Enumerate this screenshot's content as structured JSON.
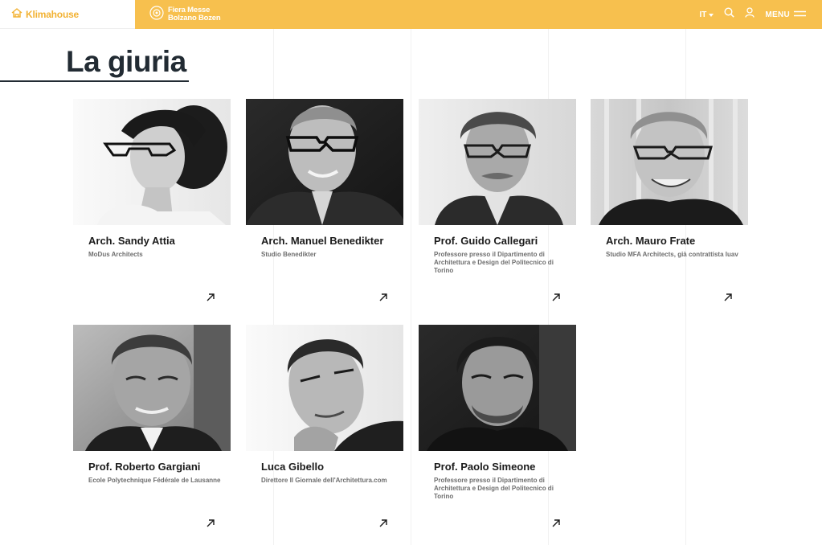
{
  "header": {
    "brand": "Klimahouse",
    "fiera_line1": "Fiera Messe",
    "fiera_line2": "Bolzano Bozen",
    "lang": "IT",
    "menu_label": "MENU"
  },
  "page": {
    "title": "La giuria"
  },
  "jury": [
    {
      "name": "Arch. Sandy Attia",
      "role": "MoDus Architects"
    },
    {
      "name": "Arch. Manuel Benedikter",
      "role": "Studio Benedikter"
    },
    {
      "name": "Prof. Guido Callegari",
      "role": "Professore presso il Dipartimento di Architettura e Design del Politecnico di Torino"
    },
    {
      "name": "Arch. Mauro Frate",
      "role": "Studio MFA Architects, già contrattista Iuav"
    },
    {
      "name": "Prof. Roberto Gargiani",
      "role": "Ecole Polytechnique Fédérale de Lausanne"
    },
    {
      "name": "Luca Gibello",
      "role": "Direttore Il Giornale dell'Architettura.com"
    },
    {
      "name": "Prof. Paolo Simeone",
      "role": "Professore presso il Dipartimento di Architettura e Design del Politecnico di Torino"
    }
  ],
  "colors": {
    "accent": "#f7c04e",
    "title": "#222b33"
  }
}
